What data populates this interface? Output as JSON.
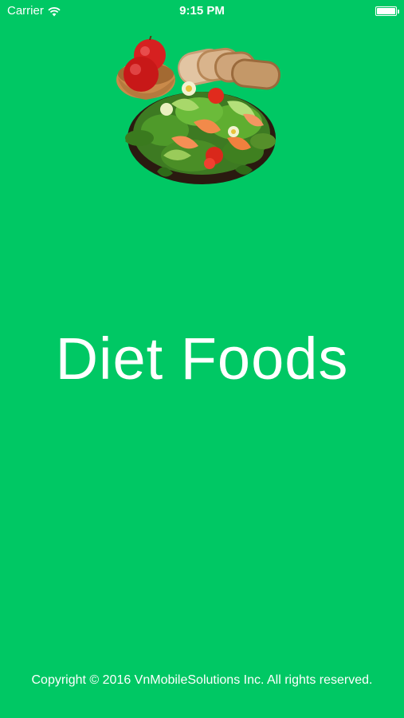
{
  "status_bar": {
    "carrier": "Carrier",
    "time": "9:15 PM",
    "battery_level": 1.0
  },
  "splash": {
    "title": "Diet Foods",
    "copyright": "Copyright © 2016 VnMobileSolutions Inc. All rights reserved."
  },
  "colors": {
    "background": "#00c864",
    "text": "#ffffff"
  },
  "icons": {
    "wifi": "wifi-icon",
    "battery": "battery-icon"
  }
}
